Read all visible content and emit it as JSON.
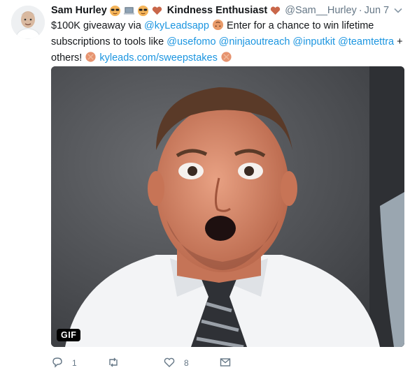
{
  "user": {
    "display_name": "Sam Hurley",
    "title": "Kindness Enthusiast",
    "handle": "@Sam__Hurley",
    "separator": "·",
    "date": "Jun 7"
  },
  "tweet": {
    "line1_prefix": "$100K giveaway via ",
    "mention_kyleads": "@kyLeadsapp",
    "line1_suffix": " Enter for a chance to win lifetime",
    "line2_prefix": "subscriptions to tools like ",
    "mention_usefomo": "@usefomo",
    "mention_ninjaoutreach": "@ninjaoutreach",
    "mention_inputkit": "@inputkit",
    "mention_teamtettra": "@teamtettra",
    "line2_suffix": " +",
    "line3_prefix": "others! ",
    "link": "kyleads.com/sweepstakes"
  },
  "media": {
    "badge": "GIF",
    "icon": "excited-man-gif"
  },
  "actions": {
    "reply_count": "1",
    "retweet_count": "",
    "like_count": "8",
    "message_count": ""
  },
  "colors": {
    "link": "#1b95e0",
    "secondary": "#657786",
    "text": "#14171a"
  }
}
